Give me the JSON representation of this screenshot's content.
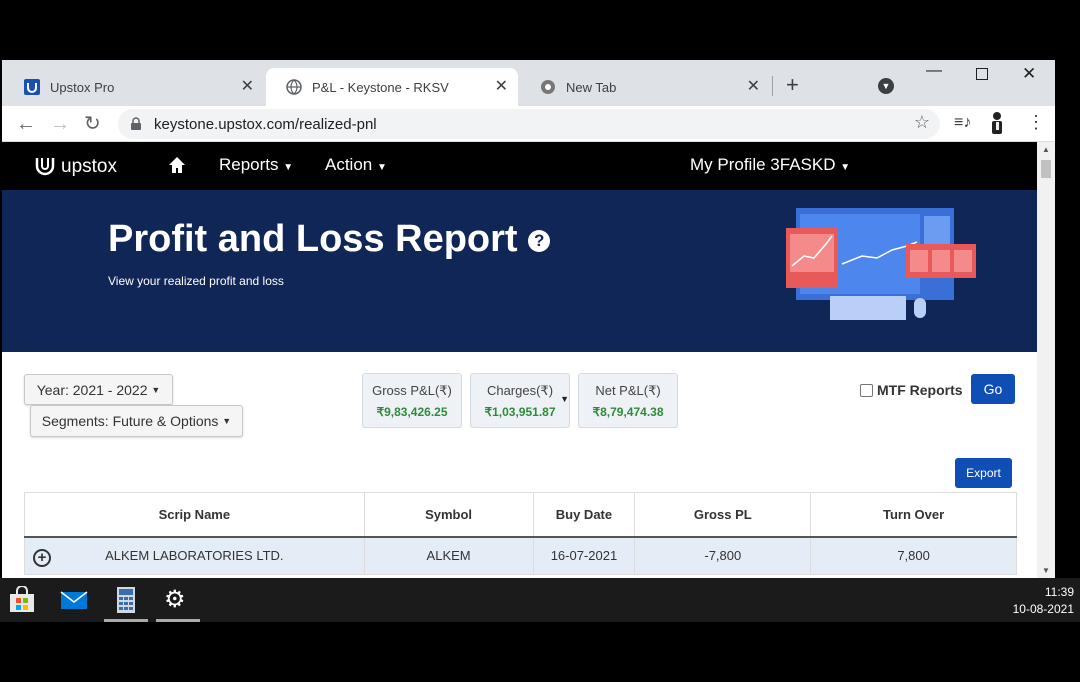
{
  "browser": {
    "tabs": [
      {
        "title": "Upstox Pro",
        "active": false
      },
      {
        "title": "P&L - Keystone - RKSV",
        "active": true
      },
      {
        "title": "New Tab",
        "active": false
      }
    ],
    "address": "keystone.upstox.com/realized-pnl"
  },
  "nav": {
    "logo": "upstox",
    "reports": "Reports",
    "action": "Action",
    "profile": "My Profile 3FASKD"
  },
  "banner": {
    "title": "Profit and Loss Report",
    "subtitle": "View your realized profit and loss"
  },
  "filters": {
    "year": "Year: 2021 - 2022",
    "segments": "Segments: Future & Options",
    "mtf_label": "MTF Reports",
    "go": "Go",
    "export": "Export"
  },
  "summary": {
    "gross_label": "Gross P&L(₹)",
    "gross_value": "₹9,83,426.25",
    "charges_label": "Charges(₹)",
    "charges_value": "₹1,03,951.87",
    "net_label": "Net P&L(₹)",
    "net_value": "₹8,79,474.38"
  },
  "table": {
    "headers": [
      "Scrip Name",
      "Symbol",
      "Buy Date",
      "Gross PL",
      "Turn Over"
    ],
    "rows": [
      [
        "ALKEM LABORATORIES LTD.",
        "ALKEM",
        "16-07-2021",
        "-7,800",
        "7,800"
      ]
    ]
  },
  "taskbar": {
    "time": "11:39",
    "date": "10-08-2021"
  },
  "colors": {
    "banner_bg": "#102656",
    "accent_blue": "#0f4eb5",
    "positive_green": "#2e8b3a"
  }
}
